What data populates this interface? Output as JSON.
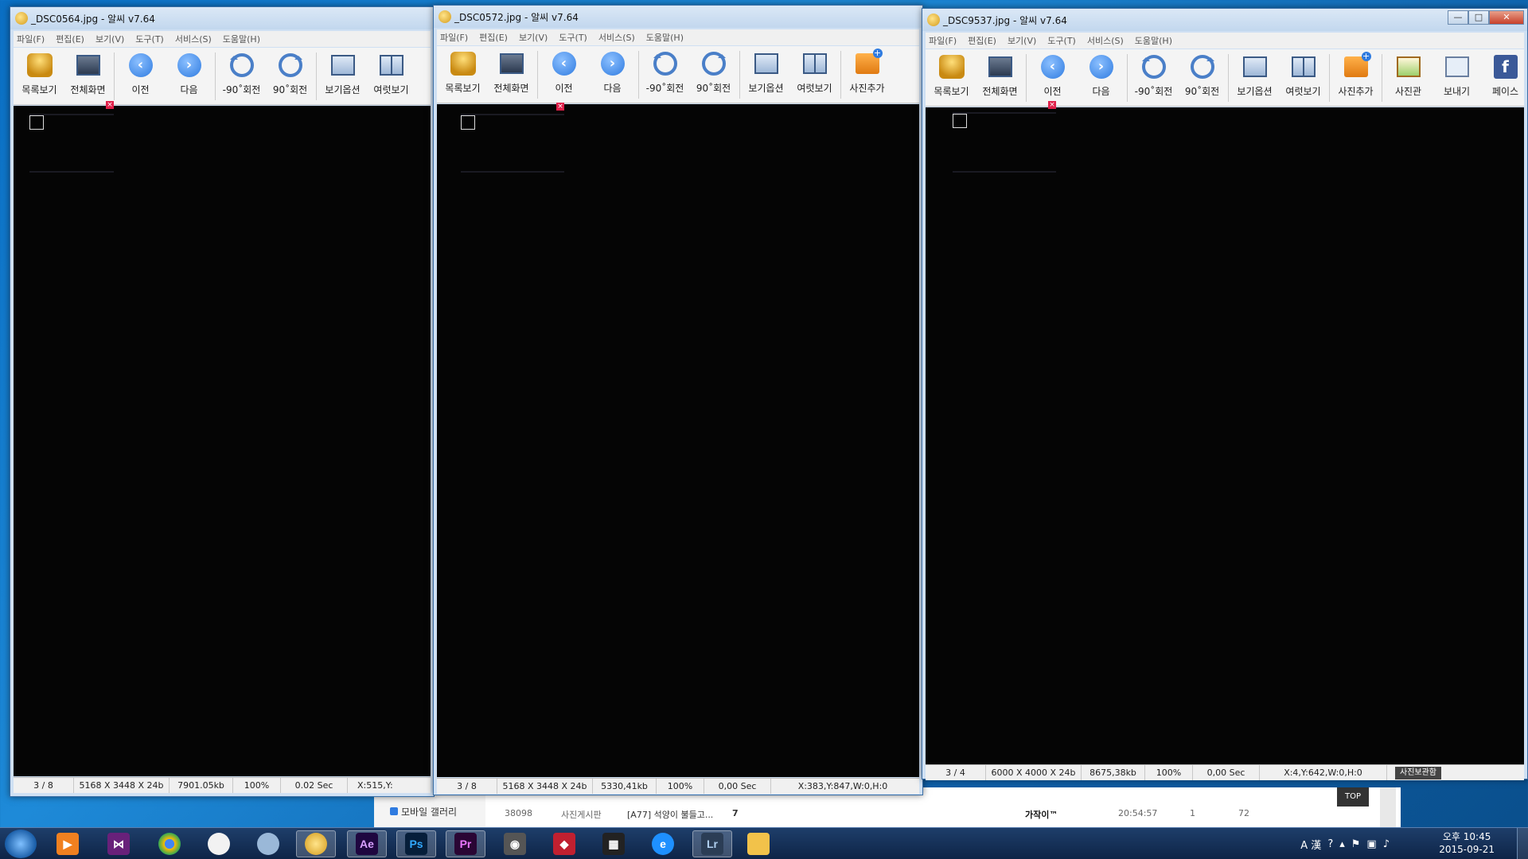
{
  "background_page": {
    "sidebar_link": "모바일 갤러리",
    "row": {
      "id": "38098",
      "board": "사진게시판",
      "title": "[A77] 석양이 불들고...",
      "comments": "7",
      "author": "가작이™",
      "time": "20:54:57",
      "recommend": "1",
      "views": "72"
    },
    "top_button": "TOP"
  },
  "menus": [
    "파일(F)",
    "편집(E)",
    "보기(V)",
    "도구(T)",
    "서비스(S)",
    "도움말(H)"
  ],
  "toolbar_labels": {
    "list": "목록보기",
    "fullscreen": "전체화면",
    "prev": "이전",
    "next": "다음",
    "rotate_left": "-90˚회전",
    "rotate_right": "90˚회전",
    "view_options": "보기옵션",
    "multi_view": "여럿보기",
    "add_photo": "사진추가",
    "gallery": "사진관",
    "send": "보내기",
    "facebook": "페이스"
  },
  "windows": [
    {
      "title": "_DSC0564.jpg - 알씨 v7.64",
      "status": {
        "index": "3 / 8",
        "dims": "5168 X 3448 X 24b",
        "size": "7901.05kb",
        "zoom": "100%",
        "time": "0.02 Sec",
        "coords": "X:515,Y:"
      }
    },
    {
      "title": "_DSC0572.jpg - 알씨 v7.64",
      "status": {
        "index": "3 / 8",
        "dims": "5168 X 3448 X 24b",
        "size": "5330,41kb",
        "zoom": "100%",
        "time": "0,00 Sec",
        "coords": "X:383,Y:847,W:0,H:0"
      }
    },
    {
      "title": "_DSC9537.jpg - 알씨 v7.64",
      "status": {
        "index": "3 / 4",
        "dims": "6000 X 4000 X 24b",
        "size": "8675,38kb",
        "zoom": "100%",
        "time": "0,00 Sec",
        "coords": "X:4,Y:642,W:0,H:0",
        "extra": "사진보관함"
      }
    }
  ],
  "window_controls": {
    "minimize": "—",
    "maximize": "□",
    "close": "✕"
  },
  "taskbar": {
    "apps": [
      "media-player",
      "visual-studio",
      "chrome",
      "alzip",
      "alsee-viewer-a",
      "alsee-viewer-b",
      "after-effects",
      "photoshop",
      "premiere",
      "camera",
      "box-app",
      "video-editor",
      "internet-explorer",
      "lightroom",
      "file-explorer"
    ],
    "ae": "Ae",
    "ps": "Ps",
    "pr": "Pr",
    "lr": "Lr",
    "tray_text": "A 漢",
    "clock_time": "오후 10:45",
    "clock_date": "2015-09-21"
  }
}
